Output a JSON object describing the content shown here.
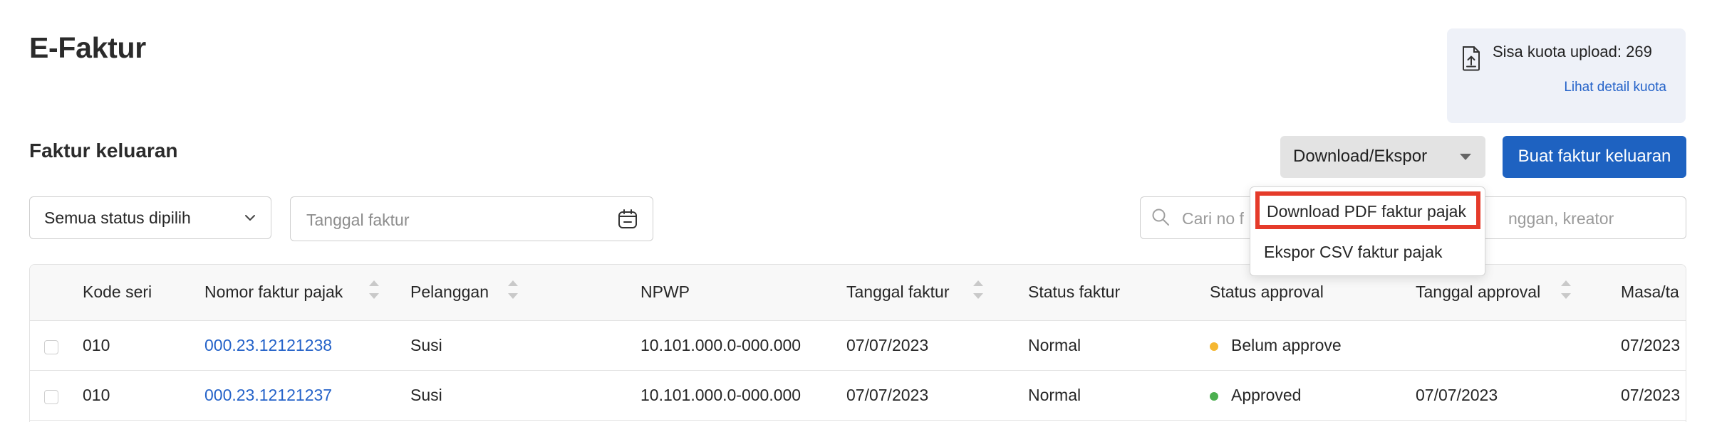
{
  "page": {
    "title": "E-Faktur",
    "section_title": "Faktur keluaran"
  },
  "quota": {
    "text": "Sisa kuota upload: 269",
    "link": "Lihat detail kuota"
  },
  "toolbar": {
    "download_label": "Download/Ekspor",
    "create_label": "Buat faktur keluaran"
  },
  "dropdown": {
    "items": [
      "Download PDF faktur pajak",
      "Ekspor CSV faktur pajak"
    ]
  },
  "filters": {
    "status_selected": "Semua status dipilih",
    "date_placeholder": "Tanggal faktur",
    "search_placeholder": "Cari no faktur, pelanggan, kreator",
    "search_visible_left": "Cari no f",
    "search_visible_right": "nggan, kreator"
  },
  "table": {
    "columns": [
      "Kode seri",
      "Nomor faktur pajak",
      "Pelanggan",
      "NPWP",
      "Tanggal faktur",
      "Status faktur",
      "Status approval",
      "Tanggal approval",
      "Masa/ta"
    ],
    "rows": [
      {
        "kode_seri": "010",
        "nomor": "000.23.12121238",
        "pelanggan": "Susi",
        "npwp": "10.101.000.0-000.000",
        "tanggal": "07/07/2023",
        "status_faktur": "Normal",
        "status_approval": "Belum approve",
        "approval_color": "#f5b731",
        "tanggal_approval": "",
        "masa": "07/2023"
      },
      {
        "kode_seri": "010",
        "nomor": "000.23.12121237",
        "pelanggan": "Susi",
        "npwp": "10.101.000.0-000.000",
        "tanggal": "07/07/2023",
        "status_faktur": "Normal",
        "status_approval": "Approved",
        "approval_color": "#4caf50",
        "tanggal_approval": "07/07/2023",
        "masa": "07/2023"
      }
    ]
  },
  "icons": {
    "quota": "upload-file-icon",
    "dropdown_caret": "caret-down-icon",
    "status_chevron": "chevron-down-icon",
    "calendar": "calendar-icon",
    "search": "search-icon",
    "sort": "sort-icon"
  }
}
